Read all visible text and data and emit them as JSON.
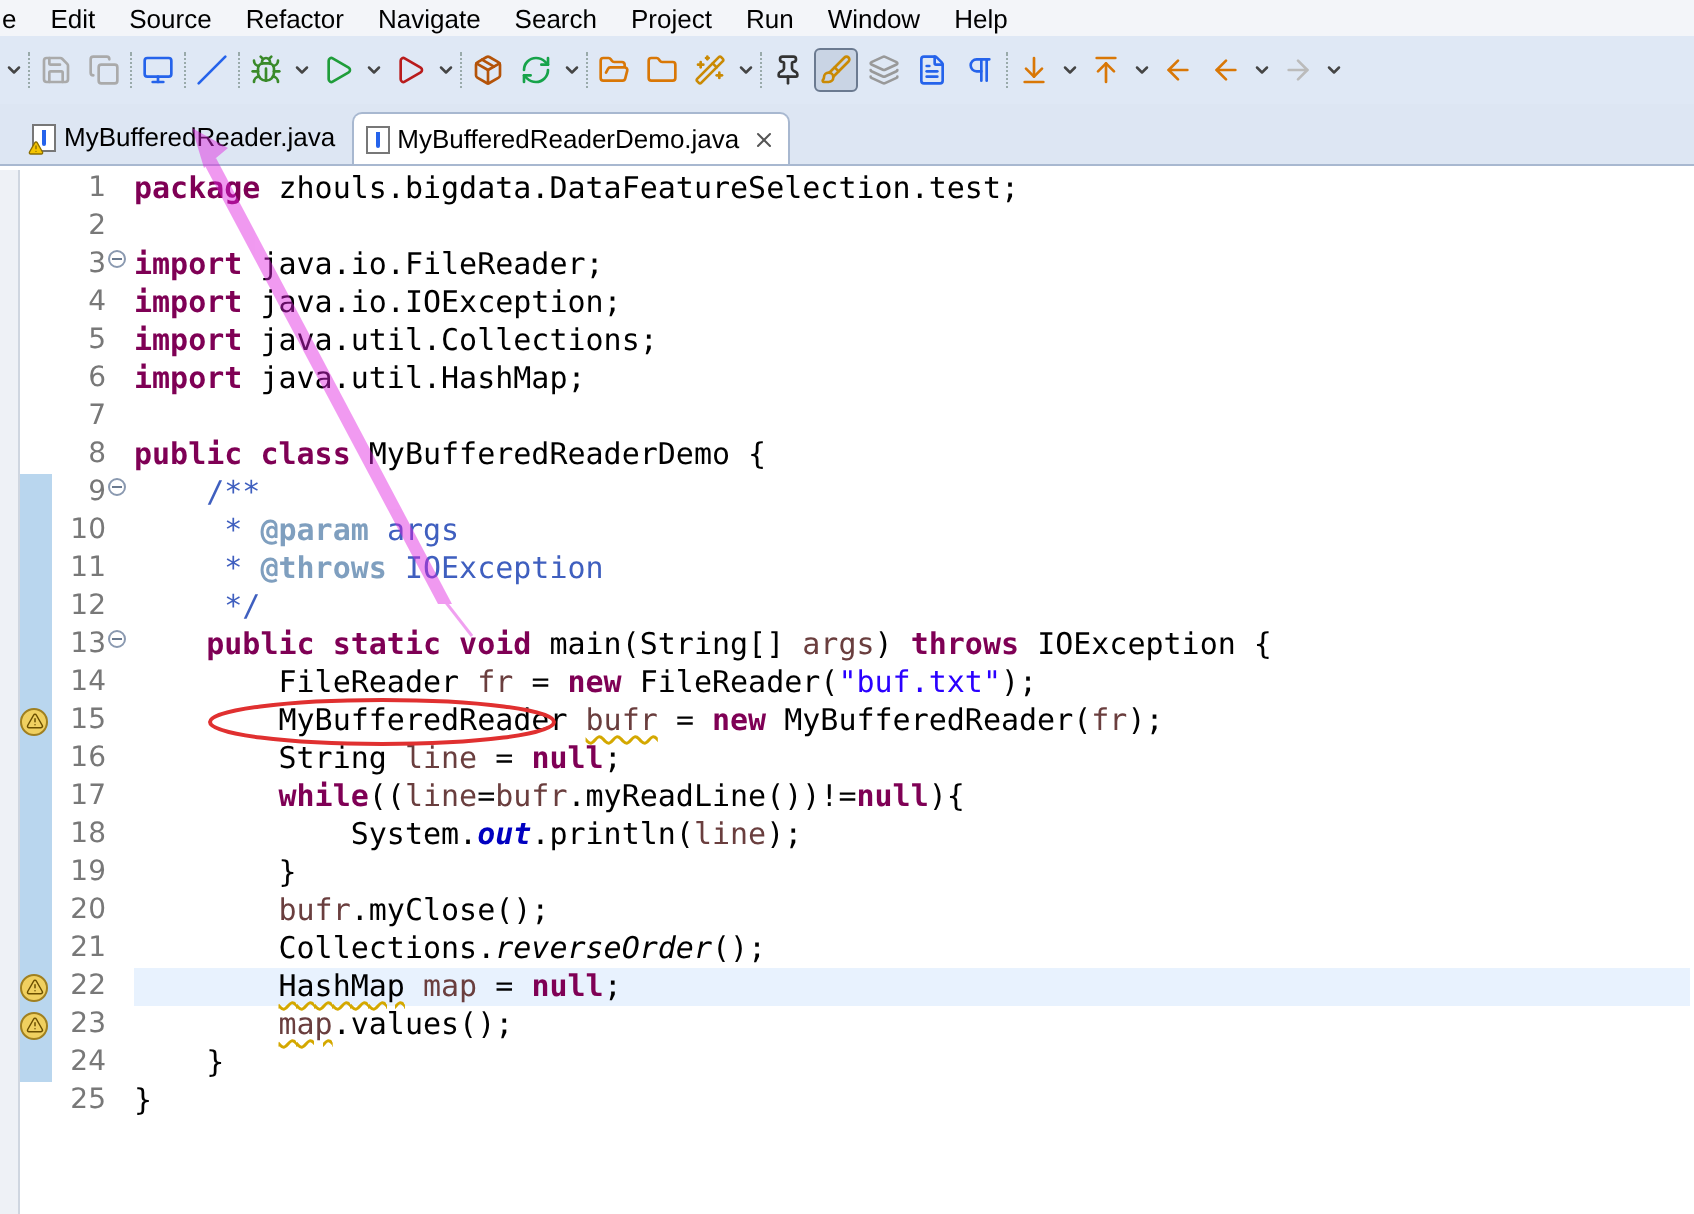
{
  "menu": [
    "e",
    "Edit",
    "Source",
    "Refactor",
    "Navigate",
    "Search",
    "Project",
    "Run",
    "Window",
    "Help"
  ],
  "toolbar": [
    {
      "kind": "dropdown"
    },
    {
      "kind": "separator"
    },
    {
      "kind": "button",
      "pressed": false
    },
    {
      "kind": "button",
      "pressed": false
    },
    {
      "kind": "separator"
    },
    {
      "kind": "button",
      "pressed": false
    },
    {
      "kind": "separator"
    },
    {
      "kind": "button",
      "pressed": false
    },
    {
      "kind": "separator"
    },
    {
      "kind": "button",
      "pressed": false
    },
    {
      "kind": "dropdown"
    },
    {
      "kind": "button",
      "pressed": false
    },
    {
      "kind": "dropdown"
    },
    {
      "kind": "button",
      "pressed": false
    },
    {
      "kind": "dropdown"
    },
    {
      "kind": "separator"
    },
    {
      "kind": "button",
      "pressed": false
    },
    {
      "kind": "button",
      "pressed": false
    },
    {
      "kind": "dropdown"
    },
    {
      "kind": "separator"
    },
    {
      "kind": "button",
      "pressed": false
    },
    {
      "kind": "button",
      "pressed": false
    },
    {
      "kind": "button",
      "pressed": false
    },
    {
      "kind": "dropdown"
    },
    {
      "kind": "separator"
    },
    {
      "kind": "button",
      "pressed": false
    },
    {
      "kind": "button",
      "pressed": true
    },
    {
      "kind": "button",
      "pressed": false
    },
    {
      "kind": "button",
      "pressed": false
    },
    {
      "kind": "button",
      "pressed": false
    },
    {
      "kind": "separator"
    },
    {
      "kind": "button",
      "pressed": false
    },
    {
      "kind": "dropdown"
    },
    {
      "kind": "button",
      "pressed": false
    },
    {
      "kind": "dropdown"
    },
    {
      "kind": "button",
      "pressed": false
    },
    {
      "kind": "button",
      "pressed": false
    },
    {
      "kind": "dropdown"
    },
    {
      "kind": "button",
      "pressed": false
    },
    {
      "kind": "dropdown"
    }
  ],
  "tabs": [
    {
      "label": "MyBufferedReader.java",
      "selected": false,
      "warning": true
    },
    {
      "label": "MyBufferedReaderDemo.java",
      "selected": true,
      "warning": false
    }
  ],
  "lines": [
    {
      "num": "1",
      "fold": false,
      "warning": false,
      "changed": false,
      "current": false,
      "tokens": [
        {
          "kind": "kw",
          "t": "package"
        },
        {
          "kind": "plain",
          "t": " zhouls.bigdata.DataFeatureSelection.test;"
        }
      ]
    },
    {
      "num": "2",
      "fold": false,
      "warning": false,
      "changed": false,
      "current": false
    },
    {
      "num": "3",
      "fold": true,
      "warning": false,
      "changed": false,
      "current": false,
      "tokens": [
        {
          "kind": "kw",
          "t": "import"
        },
        {
          "kind": "plain",
          "t": " java.io.FileReader;"
        }
      ]
    },
    {
      "num": "4",
      "fold": false,
      "warning": false,
      "changed": false,
      "current": false,
      "tokens": [
        {
          "kind": "kw",
          "t": "import"
        },
        {
          "kind": "plain",
          "t": " java.io.IOException;"
        }
      ]
    },
    {
      "num": "5",
      "fold": false,
      "warning": false,
      "changed": false,
      "current": false,
      "tokens": [
        {
          "kind": "kw",
          "t": "import"
        },
        {
          "kind": "plain",
          "t": " java.util.Collections;"
        }
      ]
    },
    {
      "num": "6",
      "fold": false,
      "warning": false,
      "changed": false,
      "current": false,
      "tokens": [
        {
          "kind": "kw",
          "t": "import"
        },
        {
          "kind": "plain",
          "t": " java.util.HashMap;"
        }
      ]
    },
    {
      "num": "7",
      "fold": false,
      "warning": false,
      "changed": false,
      "current": false
    },
    {
      "num": "8",
      "fold": false,
      "warning": false,
      "changed": false,
      "current": false,
      "tokens": [
        {
          "kind": "kw",
          "t": "public class"
        },
        {
          "kind": "plain",
          "t": " MyBufferedReaderDemo {"
        }
      ]
    },
    {
      "num": "9",
      "fold": true,
      "warning": false,
      "changed": true,
      "current": false,
      "tokens": [
        {
          "kind": "doc",
          "t": "    /**"
        }
      ]
    },
    {
      "num": "10",
      "fold": false,
      "warning": false,
      "changed": true,
      "current": false,
      "tokens": [
        {
          "kind": "doc",
          "t": "     * "
        },
        {
          "kind": "tag",
          "t": "@param"
        },
        {
          "kind": "doc",
          "t": " args"
        }
      ]
    },
    {
      "num": "11",
      "fold": false,
      "warning": false,
      "changed": true,
      "current": false,
      "tokens": [
        {
          "kind": "doc",
          "t": "     * "
        },
        {
          "kind": "tag",
          "t": "@throws"
        },
        {
          "kind": "doc",
          "t": " IOException"
        }
      ]
    },
    {
      "num": "12",
      "fold": false,
      "warning": false,
      "changed": true,
      "current": false,
      "tokens": [
        {
          "kind": "doc",
          "t": "     */"
        }
      ]
    },
    {
      "num": "13",
      "fold": true,
      "warning": false,
      "changed": true,
      "current": false,
      "tokens": [
        {
          "kind": "kw",
          "t": "    public static void"
        },
        {
          "kind": "plain",
          "t": " main(String[] "
        },
        {
          "kind": "var",
          "t": "args"
        },
        {
          "kind": "plain",
          "t": ") "
        },
        {
          "kind": "kw",
          "t": "throws"
        },
        {
          "kind": "plain",
          "t": " IOException {"
        }
      ]
    },
    {
      "num": "14",
      "fold": false,
      "warning": false,
      "changed": true,
      "current": false,
      "tokens": [
        {
          "kind": "plain",
          "t": "        FileReader "
        },
        {
          "kind": "var",
          "t": "fr"
        },
        {
          "kind": "plain",
          "t": " = "
        },
        {
          "kind": "kw",
          "t": "new"
        },
        {
          "kind": "plain",
          "t": " FileReader("
        },
        {
          "kind": "str",
          "t": "\"buf.txt\""
        },
        {
          "kind": "plain",
          "t": ");"
        }
      ]
    },
    {
      "num": "15",
      "fold": false,
      "warning": true,
      "changed": true,
      "current": false,
      "tokens": [
        {
          "kind": "plain",
          "t": "        MyBufferedReader "
        },
        {
          "kind": "var",
          "t": "bufr",
          "squiggle": true
        },
        {
          "kind": "plain",
          "t": " = "
        },
        {
          "kind": "kw",
          "t": "new"
        },
        {
          "kind": "plain",
          "t": " MyBufferedReader("
        },
        {
          "kind": "var",
          "t": "fr"
        },
        {
          "kind": "plain",
          "t": ");"
        }
      ]
    },
    {
      "num": "16",
      "fold": false,
      "warning": false,
      "changed": true,
      "current": false,
      "tokens": [
        {
          "kind": "plain",
          "t": "        String "
        },
        {
          "kind": "var",
          "t": "line"
        },
        {
          "kind": "plain",
          "t": " = "
        },
        {
          "kind": "kw",
          "t": "null"
        },
        {
          "kind": "plain",
          "t": ";"
        }
      ]
    },
    {
      "num": "17",
      "fold": false,
      "warning": false,
      "changed": true,
      "current": false,
      "tokens": [
        {
          "kind": "kw",
          "t": "        while"
        },
        {
          "kind": "plain",
          "t": "(("
        },
        {
          "kind": "var",
          "t": "line"
        },
        {
          "kind": "plain",
          "t": "="
        },
        {
          "kind": "var",
          "t": "bufr"
        },
        {
          "kind": "plain",
          "t": ".myReadLine())!="
        },
        {
          "kind": "kw",
          "t": "null"
        },
        {
          "kind": "plain",
          "t": "){"
        }
      ]
    },
    {
      "num": "18",
      "fold": false,
      "warning": false,
      "changed": true,
      "current": false,
      "tokens": [
        {
          "kind": "plain",
          "t": "            System."
        },
        {
          "kind": "field",
          "t": "out"
        },
        {
          "kind": "plain",
          "t": ".println("
        },
        {
          "kind": "var",
          "t": "line"
        },
        {
          "kind": "plain",
          "t": ");"
        }
      ]
    },
    {
      "num": "19",
      "fold": false,
      "warning": false,
      "changed": true,
      "current": false,
      "tokens": [
        {
          "kind": "plain",
          "t": "        }"
        }
      ]
    },
    {
      "num": "20",
      "fold": false,
      "warning": false,
      "changed": true,
      "current": false,
      "tokens": [
        {
          "kind": "var",
          "t": "        bufr"
        },
        {
          "kind": "plain",
          "t": ".myClose();"
        }
      ]
    },
    {
      "num": "21",
      "fold": false,
      "warning": false,
      "changed": true,
      "current": false,
      "tokens": [
        {
          "kind": "plain",
          "t": "        Collections."
        },
        {
          "kind": "static",
          "t": "reverseOrder"
        },
        {
          "kind": "plain",
          "t": "();"
        }
      ]
    },
    {
      "num": "22",
      "fold": false,
      "warning": true,
      "changed": true,
      "current": true,
      "tokens": [
        {
          "kind": "plain",
          "t": "        HashMap",
          "squiggle": true
        },
        {
          "kind": "var",
          "t": " map"
        },
        {
          "kind": "plain",
          "t": " = "
        },
        {
          "kind": "kw",
          "t": "null"
        },
        {
          "kind": "plain",
          "t": ";"
        }
      ]
    },
    {
      "num": "23",
      "fold": false,
      "warning": true,
      "changed": true,
      "current": false,
      "tokens": [
        {
          "kind": "var",
          "t": "        map",
          "squiggle": true
        },
        {
          "kind": "plain",
          "t": ".values();"
        }
      ]
    },
    {
      "num": "24",
      "fold": false,
      "warning": false,
      "changed": true,
      "current": false,
      "tokens": [
        {
          "kind": "plain",
          "t": "    }"
        }
      ]
    },
    {
      "num": "25",
      "fold": false,
      "warning": false,
      "changed": false,
      "current": false,
      "tokens": [
        {
          "kind": "plain",
          "t": "}"
        }
      ]
    }
  ],
  "annotations": {
    "arrow": true,
    "ellipse": true
  }
}
